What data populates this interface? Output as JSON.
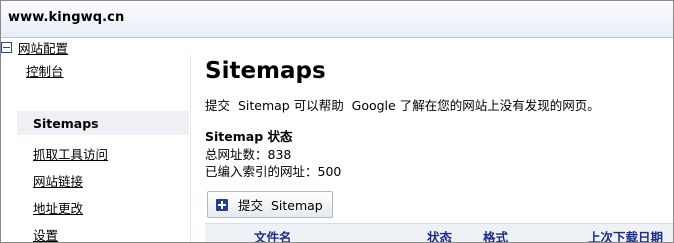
{
  "header": {
    "site_url": "www.kingwq.cn"
  },
  "sidebar": {
    "dashboard": "控制台",
    "site_config": "网站配置",
    "items": [
      {
        "label": "Sitemaps",
        "active": true
      },
      {
        "label": "抓取工具访问"
      },
      {
        "label": "网站链接"
      },
      {
        "label": "地址更改"
      },
      {
        "label": "设置"
      }
    ]
  },
  "main": {
    "title": "Sitemaps",
    "intro": "提交  Sitemap 可以帮助  Google 了解在您的网站上没有发现的网页。",
    "status_title": "Sitemap 状态",
    "total_urls": "总网址数：838",
    "indexed_urls": "已编入索引的网址：500",
    "submit_button": "提交  Sitemap",
    "table_headers": {
      "filename": "文件名",
      "status": "状态",
      "format": "格式",
      "last_download": "上次下载日期"
    }
  },
  "icons": {
    "collapse": "minus-box-icon",
    "submit": "plus-icon"
  },
  "colors": {
    "link_header": "#1a2f8a",
    "icon_blue": "#263f8a",
    "active_row": "#eef0f5"
  }
}
